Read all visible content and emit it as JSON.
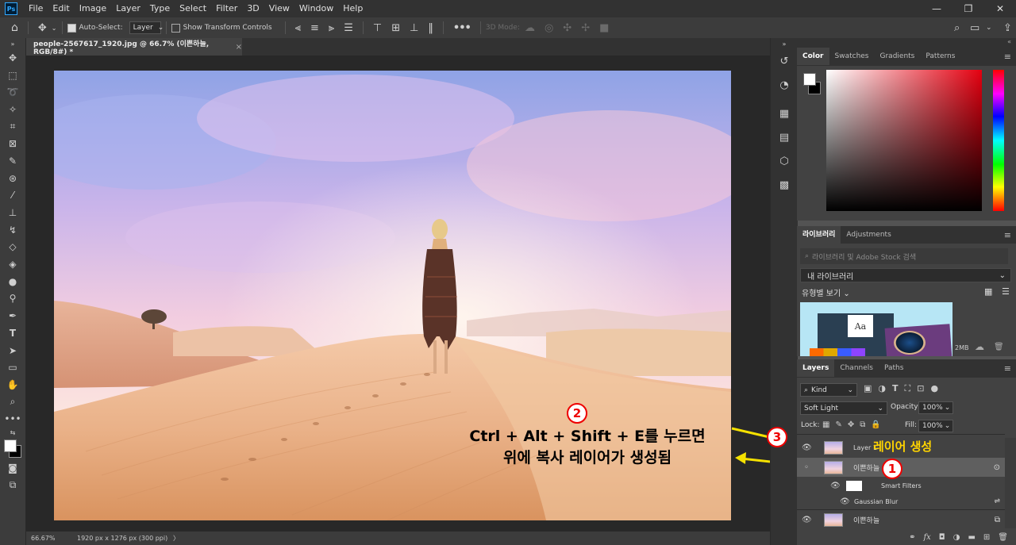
{
  "app": {
    "logo": "Ps"
  },
  "menu": [
    "File",
    "Edit",
    "Image",
    "Layer",
    "Type",
    "Select",
    "Filter",
    "3D",
    "View",
    "Window",
    "Help"
  ],
  "window_controls": {
    "minimize": "—",
    "restore": "❐",
    "close": "✕"
  },
  "options_bar": {
    "auto_select_label": "Auto-Select:",
    "auto_select_value": "Layer",
    "show_transform_label": "Show Transform Controls",
    "more": "•••",
    "mode_3d_label": "3D Mode:"
  },
  "document_tab": {
    "title": "people-2567617_1920.jpg @ 66.7% (이쁜하늘, RGB/8#) *",
    "close": "×"
  },
  "status": {
    "zoom": "66.67%",
    "doc_info": "1920 px x 1276 px (300 ppi)",
    "arrow": "〉"
  },
  "annotations": {
    "step2": "2",
    "step1": "1",
    "step3": "3",
    "text_line1": "Ctrl + Alt + Shift + E를 누르면",
    "text_line2": "위에 복사 레이어가 생성됨",
    "layer_created": "레이어 생성"
  },
  "color_panel": {
    "tabs": [
      "Color",
      "Swatches",
      "Gradients",
      "Patterns"
    ],
    "active_tab": "Color"
  },
  "library_panel": {
    "tabs": [
      "라이브러리",
      "Adjustments"
    ],
    "search_placeholder": "라이브러리 및 Adobe Stock 검색",
    "library_name": "내 라이브러리",
    "view_by": "유형별 보기",
    "size": "2MB",
    "sample_text": "Aa"
  },
  "layers_panel": {
    "tabs": [
      "Layers",
      "Channels",
      "Paths"
    ],
    "filter_kind": "Kind",
    "blend_mode": "Soft Light",
    "opacity_label": "Opacity:",
    "opacity_value": "100%",
    "lock_label": "Lock:",
    "fill_label": "Fill:",
    "fill_value": "100%",
    "layers": [
      {
        "name": "Layer 1"
      },
      {
        "name": "이쁜하늘"
      },
      {
        "name": "Smart Filters"
      },
      {
        "name": "Gaussian Blur"
      },
      {
        "name": "이쁜하늘"
      }
    ],
    "footer_fx": "fx"
  },
  "colors": {
    "accent": "#e00000",
    "annotation_yellow": "#ffd400",
    "arrow": "#f5e100"
  }
}
